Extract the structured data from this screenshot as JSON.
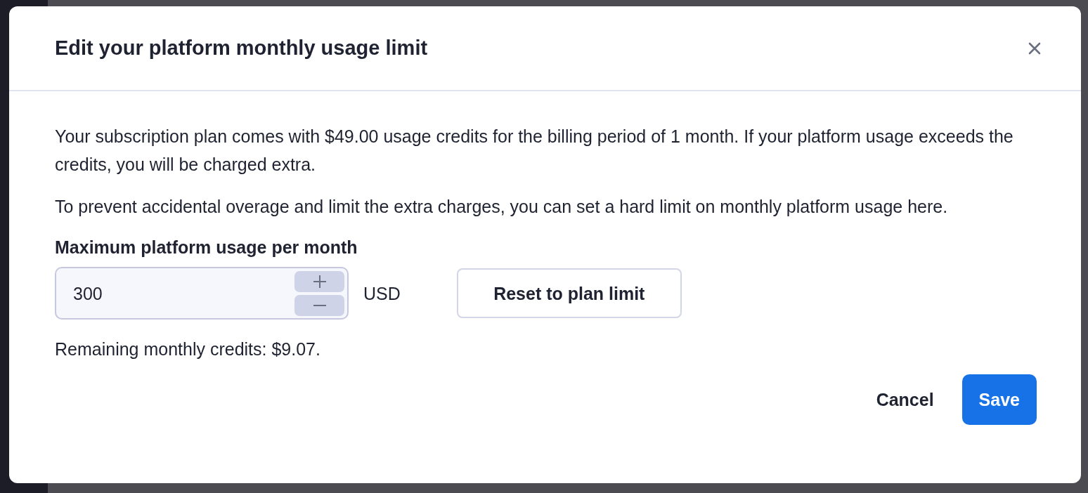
{
  "dialog": {
    "title": "Edit your platform monthly usage limit",
    "paragraphs": [
      "Your subscription plan comes with $49.00 usage credits for the billing period of 1 month. If your platform usage exceeds the credits, you will be charged extra.",
      "To prevent accidental overage and limit the extra charges, you can set a hard limit on monthly platform usage here."
    ],
    "field": {
      "label": "Maximum platform usage per month",
      "value": "300",
      "unit": "USD"
    },
    "reset_button": "Reset to plan limit",
    "remaining": "Remaining monthly credits: $9.07.",
    "buttons": [
      {
        "label": "Cancel",
        "kind": "secondary"
      },
      {
        "label": "Save",
        "kind": "primary"
      }
    ]
  }
}
